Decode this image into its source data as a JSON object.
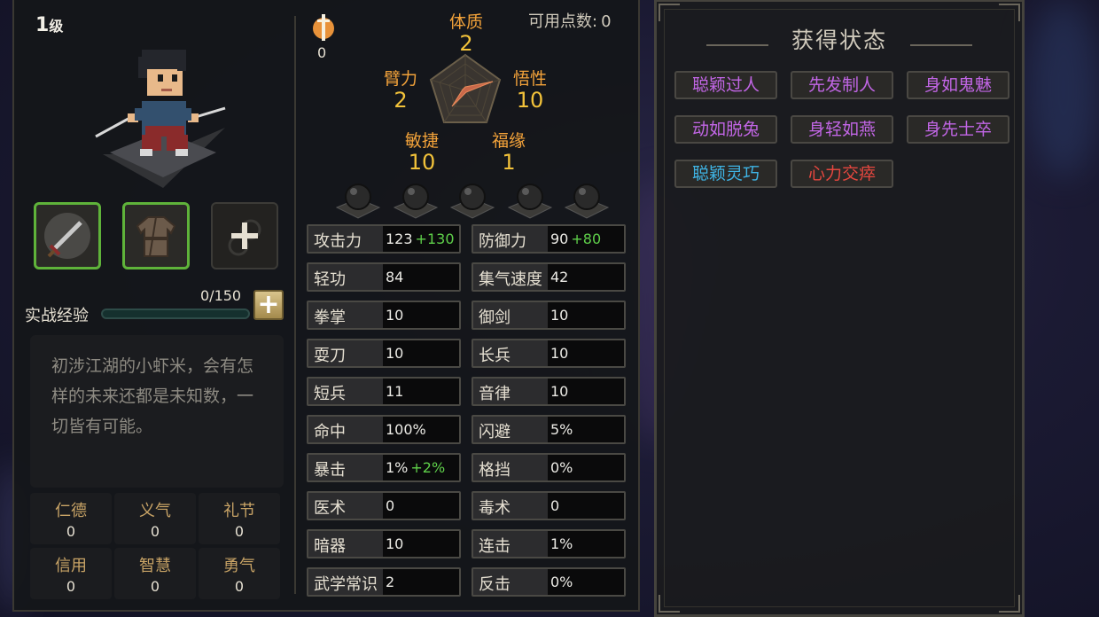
{
  "character": {
    "level_number": "1",
    "level_unit": "级",
    "available_points_label": "可用点数:",
    "available_points_value": "0",
    "points_icon_count": "0",
    "description": "初涉江湖的小虾米，会有怎样的未来还都是未知数，一切皆有可能。"
  },
  "experience": {
    "label": "实战经验",
    "value": "0/150",
    "progress": 0,
    "plus_label": "+"
  },
  "equipment": [
    {
      "name": "sword-icon",
      "state": "equipped"
    },
    {
      "name": "robe-icon",
      "state": "equipped"
    },
    {
      "name": "empty-slot-plus-icon",
      "state": "empty",
      "label": "+"
    }
  ],
  "virtues": [
    {
      "name": "仁德",
      "value": "0"
    },
    {
      "name": "义气",
      "value": "0"
    },
    {
      "name": "礼节",
      "value": "0"
    },
    {
      "name": "信用",
      "value": "0"
    },
    {
      "name": "智慧",
      "value": "0"
    },
    {
      "name": "勇气",
      "value": "0"
    }
  ],
  "attributes": {
    "tizhi": {
      "name": "体质",
      "value": "2"
    },
    "wuxing": {
      "name": "悟性",
      "value": "10"
    },
    "fuyuan": {
      "name": "福缘",
      "value": "1"
    },
    "minjie": {
      "name": "敏捷",
      "value": "10"
    },
    "bili": {
      "name": "臂力",
      "value": "2"
    }
  },
  "stats_left": [
    {
      "name": "攻击力",
      "value": "123",
      "bonus": "+130"
    },
    {
      "name": "轻功",
      "value": "84",
      "bonus": ""
    },
    {
      "name": "拳掌",
      "value": "10",
      "bonus": ""
    },
    {
      "name": "耍刀",
      "value": "10",
      "bonus": ""
    },
    {
      "name": "短兵",
      "value": "11",
      "bonus": ""
    },
    {
      "name": "命中",
      "value": "100%",
      "bonus": ""
    },
    {
      "name": "暴击",
      "value": "1%",
      "bonus": "+2%"
    },
    {
      "name": "医术",
      "value": "0",
      "bonus": ""
    },
    {
      "name": "暗器",
      "value": "10",
      "bonus": ""
    },
    {
      "name": "武学常识",
      "value": "2",
      "bonus": ""
    }
  ],
  "stats_right": [
    {
      "name": "防御力",
      "value": "90",
      "bonus": "+80"
    },
    {
      "name": "集气速度",
      "value": "42",
      "bonus": ""
    },
    {
      "name": "御剑",
      "value": "10",
      "bonus": ""
    },
    {
      "name": "长兵",
      "value": "10",
      "bonus": ""
    },
    {
      "name": "音律",
      "value": "10",
      "bonus": ""
    },
    {
      "name": "闪避",
      "value": "5%",
      "bonus": ""
    },
    {
      "name": "格挡",
      "value": "0%",
      "bonus": ""
    },
    {
      "name": "毒术",
      "value": "0",
      "bonus": ""
    },
    {
      "name": "连击",
      "value": "1%",
      "bonus": ""
    },
    {
      "name": "反击",
      "value": "0%",
      "bonus": ""
    }
  ],
  "status_panel": {
    "title": "获得状态",
    "tags": [
      {
        "label": "聪颖过人",
        "color": "#c266e6"
      },
      {
        "label": "先发制人",
        "color": "#c266e6"
      },
      {
        "label": "身如鬼魅",
        "color": "#c266e6"
      },
      {
        "label": "动如脱兔",
        "color": "#c266e6"
      },
      {
        "label": "身轻如燕",
        "color": "#c266e6"
      },
      {
        "label": "身先士卒",
        "color": "#c266e6"
      },
      {
        "label": "聪颖灵巧",
        "color": "#3fb5e6"
      },
      {
        "label": "心力交瘁",
        "color": "#e6473f"
      }
    ]
  },
  "colors": {
    "attribute_name": "#f2a23a",
    "attribute_value": "#f2c23a",
    "virtue_name": "#c9a466",
    "bonus": "#5fd04a",
    "equip_border": "#5fb33a"
  },
  "gem_slots": 5
}
